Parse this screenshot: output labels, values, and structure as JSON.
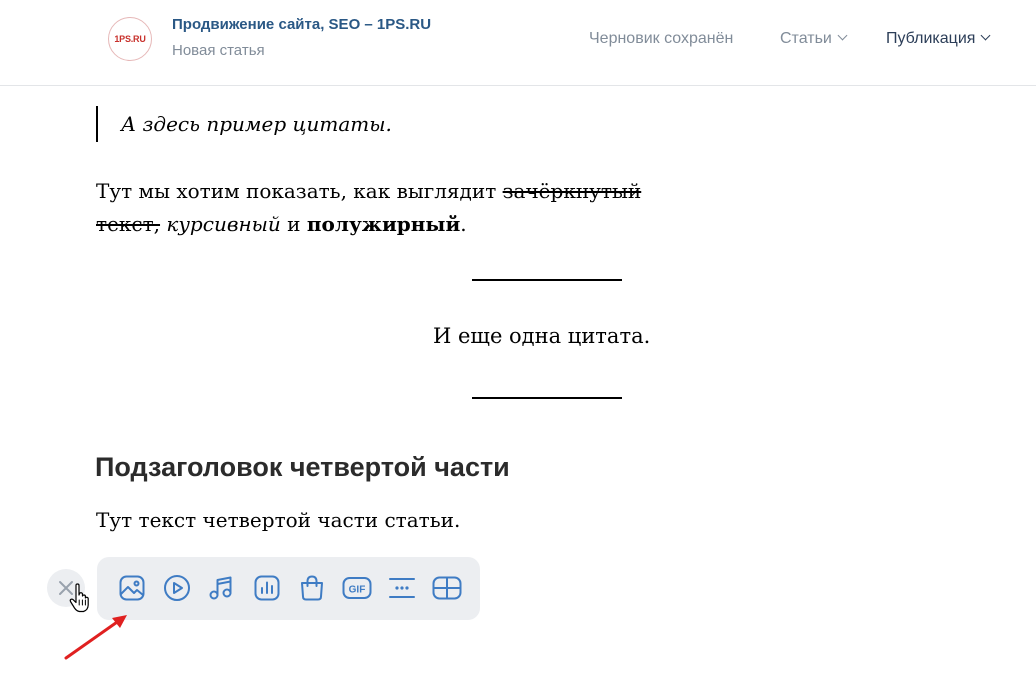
{
  "header": {
    "logo_text": "1PS.RU",
    "site_title": "Продвижение сайта, SEO – 1PS.RU",
    "subtitle": "Новая статья",
    "draft_status": "Черновик сохранён",
    "articles_menu": "Статьи",
    "publish_menu": "Публикация"
  },
  "article": {
    "quote": "А здесь пример цитаты.",
    "para1": {
      "text_before": "Тут мы хотим показать, как выглядит ",
      "strike": "зачёркнутый текст,",
      "text_mid": " ",
      "italic": "курсивный",
      "text_and": " и ",
      "bold": "полужирный",
      "text_end": "."
    },
    "center_quote": "И еще одна цитата.",
    "subheading": "Подзаголовок четвертой части",
    "para2": "Тут текст четвертой части статьи."
  },
  "toolbar": {
    "tools": [
      {
        "icon": "image-icon"
      },
      {
        "icon": "video-icon"
      },
      {
        "icon": "music-icon"
      },
      {
        "icon": "chart-icon"
      },
      {
        "icon": "product-bag-icon"
      },
      {
        "icon": "gif-icon"
      },
      {
        "icon": "separator-icon"
      },
      {
        "icon": "table-icon"
      }
    ],
    "gif_label": "GIF"
  },
  "colors": {
    "accent": "#2a5885",
    "icon": "#3f7cc4",
    "muted": "#818c99",
    "toolbar_bg": "#eceef1",
    "arrow": "#e02020"
  }
}
